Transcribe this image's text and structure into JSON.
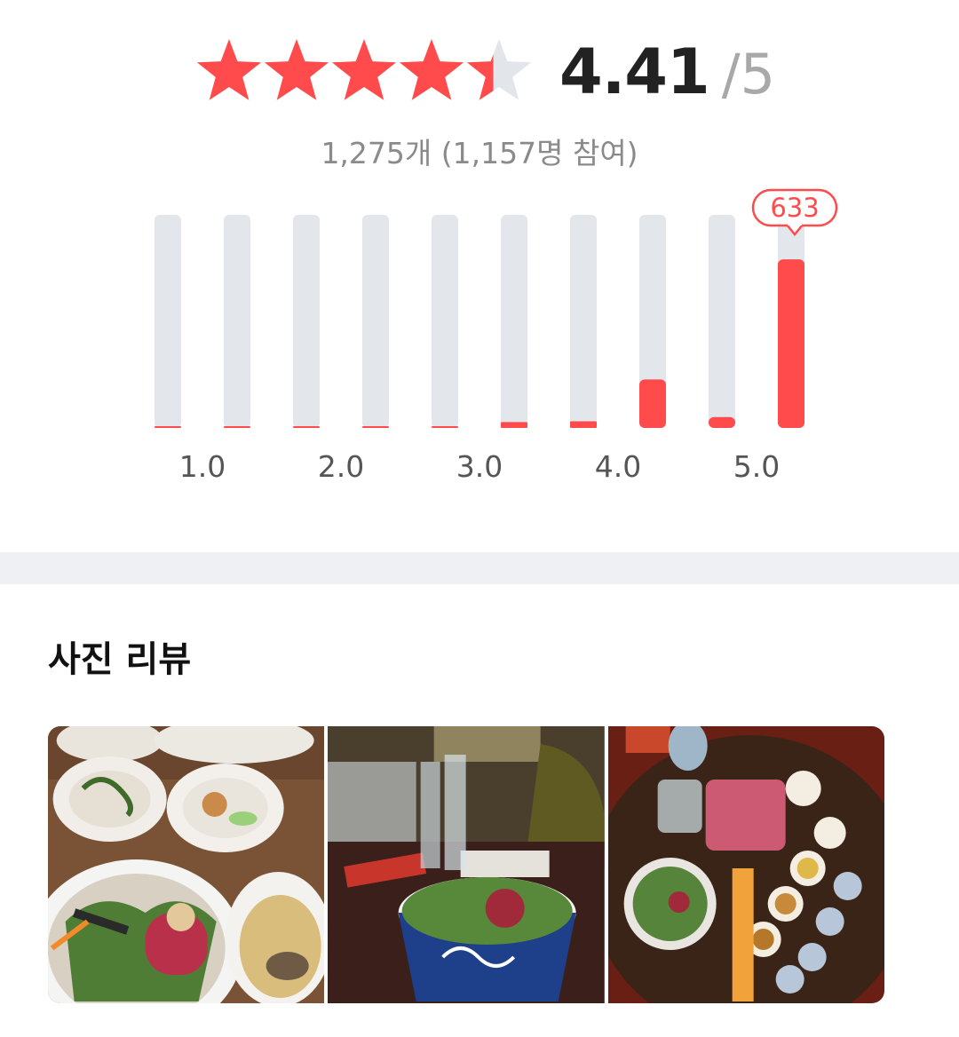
{
  "rating": {
    "value": "4.41",
    "max": "/5",
    "stars_filled_fraction": 0.882,
    "review_count_text": "1,275개 (1,157명 참여)"
  },
  "colors": {
    "accent": "#ff4b4b",
    "star_empty": "#e2e5ea",
    "bar_track": "#e3e6ea"
  },
  "chart_data": {
    "type": "bar",
    "categories": [
      "0.5",
      "1.0",
      "1.5",
      "2.0",
      "2.5",
      "3.0",
      "3.5",
      "4.0",
      "4.5",
      "5.0"
    ],
    "values": [
      1,
      1,
      1,
      3,
      4,
      22,
      25,
      182,
      41,
      633
    ],
    "ylim": [
      0,
      800
    ],
    "tick_labels": [
      "1.0",
      "2.0",
      "3.0",
      "4.0",
      "5.0"
    ],
    "highlight": {
      "category": "5.0",
      "label": "633"
    }
  },
  "photo_reviews": {
    "title": "사진 리뷰",
    "photos": [
      {
        "icon": "bibimbap-with-side-dishes-photo"
      },
      {
        "icon": "bibimbap-bowl-with-wine-glasses-photo"
      },
      {
        "icon": "bibimbap-table-top-view-photo"
      }
    ]
  }
}
